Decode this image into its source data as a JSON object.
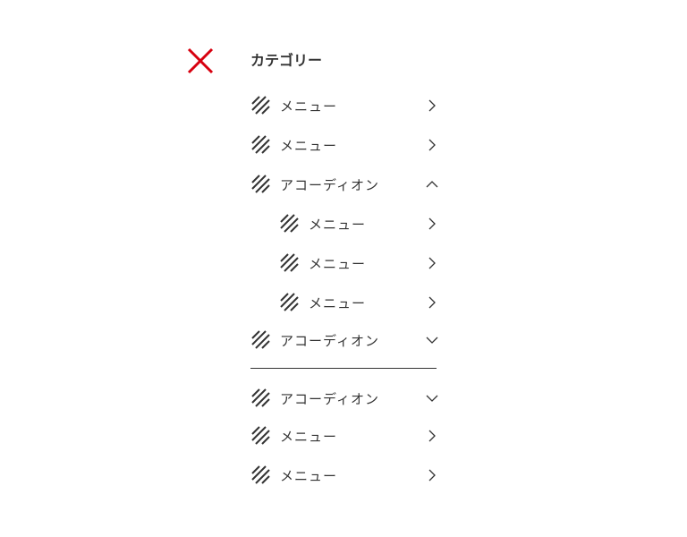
{
  "close_icon_color": "#d7000f",
  "nav": {
    "title": "カテゴリー",
    "group1": [
      {
        "label": "メニュー",
        "icon": "hatch-icon",
        "arrow": "chevron-right-icon"
      },
      {
        "label": "メニュー",
        "icon": "hatch-icon",
        "arrow": "chevron-right-icon"
      },
      {
        "label": "アコーディオン",
        "icon": "hatch-icon",
        "arrow": "chevron-up-icon",
        "expanded": true
      },
      {
        "label": "メニュー",
        "icon": "hatch-icon",
        "arrow": "chevron-right-icon",
        "level": 2
      },
      {
        "label": "メニュー",
        "icon": "hatch-icon",
        "arrow": "chevron-right-icon",
        "level": 2
      },
      {
        "label": "メニュー",
        "icon": "hatch-icon",
        "arrow": "chevron-right-icon",
        "level": 2
      },
      {
        "label": "アコーディオン",
        "icon": "hatch-icon",
        "arrow": "chevron-down-icon",
        "expanded": false
      }
    ],
    "group2": [
      {
        "label": "アコーディオン",
        "icon": "hatch-icon",
        "arrow": "chevron-down-icon",
        "expanded": false
      },
      {
        "label": "メニュー",
        "icon": "hatch-icon",
        "arrow": "chevron-right-icon"
      },
      {
        "label": "メニュー",
        "icon": "hatch-icon",
        "arrow": "chevron-right-icon"
      }
    ]
  }
}
